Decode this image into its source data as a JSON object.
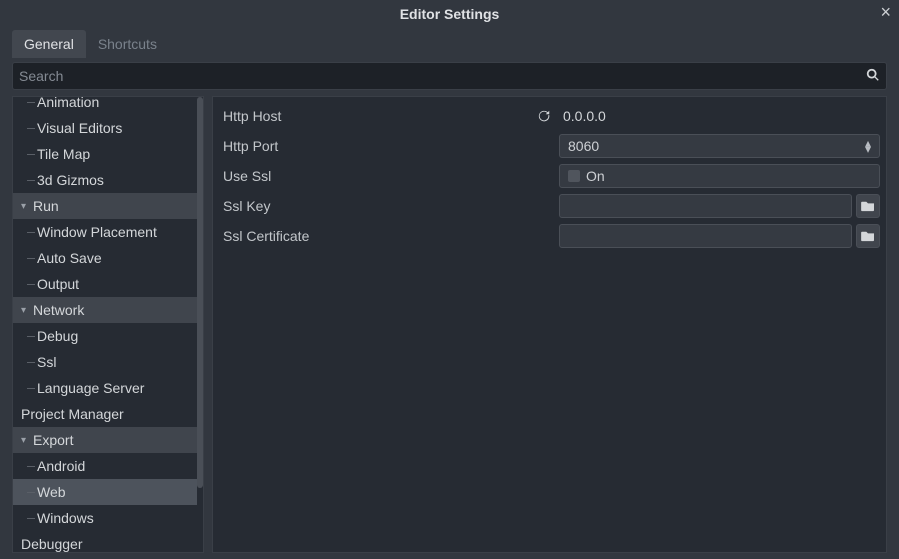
{
  "window": {
    "title": "Editor Settings"
  },
  "tabs": {
    "general": "General",
    "shortcuts": "Shortcuts"
  },
  "search": {
    "placeholder": "Search"
  },
  "tree": {
    "animation": "Animation",
    "visual_editors": "Visual Editors",
    "tile_map": "Tile Map",
    "gizmos": "3d Gizmos",
    "run": "Run",
    "window_placement": "Window Placement",
    "auto_save": "Auto Save",
    "output": "Output",
    "network": "Network",
    "debug": "Debug",
    "ssl": "Ssl",
    "language_server": "Language Server",
    "project_manager": "Project Manager",
    "export": "Export",
    "android": "Android",
    "web": "Web",
    "windows": "Windows",
    "debugger": "Debugger"
  },
  "props": {
    "http_host": {
      "label": "Http Host",
      "value": "0.0.0.0"
    },
    "http_port": {
      "label": "Http Port",
      "value": "8060"
    },
    "use_ssl": {
      "label": "Use Ssl",
      "value": "On"
    },
    "ssl_key": {
      "label": "Ssl Key",
      "value": ""
    },
    "ssl_cert": {
      "label": "Ssl Certificate",
      "value": ""
    }
  }
}
